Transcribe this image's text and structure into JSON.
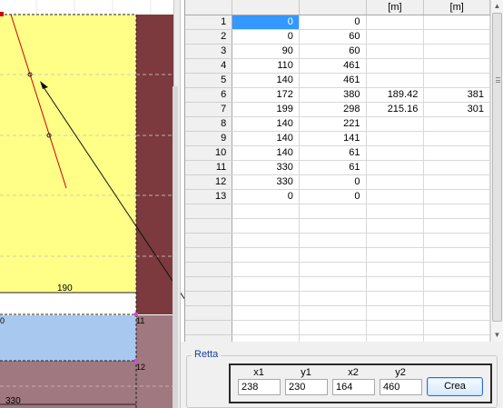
{
  "drawing": {
    "dim_labels": [
      "190",
      "330"
    ],
    "node_labels": [
      "11",
      "12"
    ],
    "partial_label": "0",
    "colors": {
      "yellow_region": "#ffff88",
      "blue_region": "#a8c8f0",
      "brown_region": "#7c3a3e",
      "mauve_region": "#a07880",
      "red_line": "#cc0000",
      "magenta_marker": "#e040e0"
    }
  },
  "grid": {
    "units_headers": [
      "",
      "",
      "",
      "[m]",
      "[m]"
    ],
    "rows": [
      {
        "n": "1",
        "a": "0",
        "b": "0",
        "c": "",
        "d": ""
      },
      {
        "n": "2",
        "a": "0",
        "b": "60",
        "c": "",
        "d": ""
      },
      {
        "n": "3",
        "a": "90",
        "b": "60",
        "c": "",
        "d": ""
      },
      {
        "n": "4",
        "a": "110",
        "b": "461",
        "c": "",
        "d": ""
      },
      {
        "n": "5",
        "a": "140",
        "b": "461",
        "c": "",
        "d": ""
      },
      {
        "n": "6",
        "a": "172",
        "b": "380",
        "c": "189.42",
        "d": "381"
      },
      {
        "n": "7",
        "a": "199",
        "b": "298",
        "c": "215.16",
        "d": "301"
      },
      {
        "n": "8",
        "a": "140",
        "b": "221",
        "c": "",
        "d": ""
      },
      {
        "n": "9",
        "a": "140",
        "b": "141",
        "c": "",
        "d": ""
      },
      {
        "n": "10",
        "a": "140",
        "b": "61",
        "c": "",
        "d": ""
      },
      {
        "n": "11",
        "a": "330",
        "b": "61",
        "c": "",
        "d": ""
      },
      {
        "n": "12",
        "a": "330",
        "b": "0",
        "c": "",
        "d": ""
      },
      {
        "n": "13",
        "a": "0",
        "b": "0",
        "c": "",
        "d": ""
      }
    ],
    "empty_rows": 10,
    "selected": {
      "row": 0,
      "col": "a"
    }
  },
  "retta": {
    "title": "Retta",
    "labels": {
      "x1": "x1",
      "y1": "y1",
      "x2": "x2",
      "y2": "y2"
    },
    "values": {
      "x1": "238",
      "y1": "230",
      "x2": "164",
      "y2": "460"
    },
    "button_label": "Crea"
  }
}
